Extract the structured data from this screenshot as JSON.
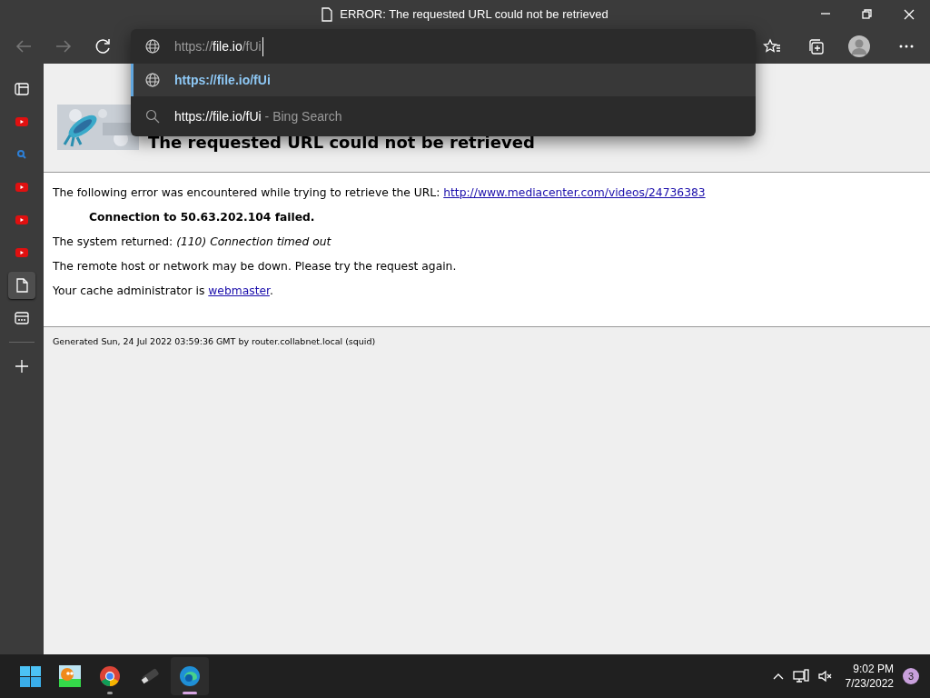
{
  "window": {
    "title": "ERROR: The requested URL could not be retrieved"
  },
  "address": {
    "scheme": "https://",
    "host": "file.io",
    "path": "/fUi"
  },
  "suggestions": [
    {
      "kind": "url",
      "text": "https://file.io/fUi",
      "selected": true
    },
    {
      "kind": "search",
      "text": "https://file.io/fUi",
      "hint": "- Bing Search",
      "selected": false
    }
  ],
  "sidebar": {
    "items": [
      {
        "kind": "tabs",
        "selected": false
      },
      {
        "kind": "video",
        "selected": false
      },
      {
        "kind": "search",
        "selected": false
      },
      {
        "kind": "video",
        "selected": false
      },
      {
        "kind": "video",
        "selected": false
      },
      {
        "kind": "video",
        "selected": false
      },
      {
        "kind": "page",
        "selected": true
      },
      {
        "kind": "collection",
        "selected": false
      }
    ]
  },
  "page": {
    "heading": "The requested URL could not be retrieved",
    "intro": "The following error was encountered while trying to retrieve the URL:",
    "url_link": "http://www.mediacenter.com/videos/24736383",
    "failure": "Connection to 50.63.202.104 failed.",
    "system_returned": "The system returned: *(110) Connection timed out*",
    "advice": "The remote host or network may be down. Please try the request again.",
    "admin_text": "Your cache administrator is",
    "admin_link": "webmaster",
    "admin_end": ".",
    "footer": "Generated Sun, 24 Jul 2022 03:59:36 GMT by router.collabnet.local (squid)"
  },
  "taskbar": {
    "apps": [
      {
        "kind": "start",
        "running": false,
        "active": false
      },
      {
        "kind": "game",
        "running": false,
        "active": false
      },
      {
        "kind": "chrome",
        "running": true,
        "active": false
      },
      {
        "kind": "usb",
        "running": false,
        "active": false
      },
      {
        "kind": "edge",
        "running": true,
        "active": true
      }
    ],
    "time": "9:02 PM",
    "date": "7/23/2022",
    "notifications": "3"
  }
}
